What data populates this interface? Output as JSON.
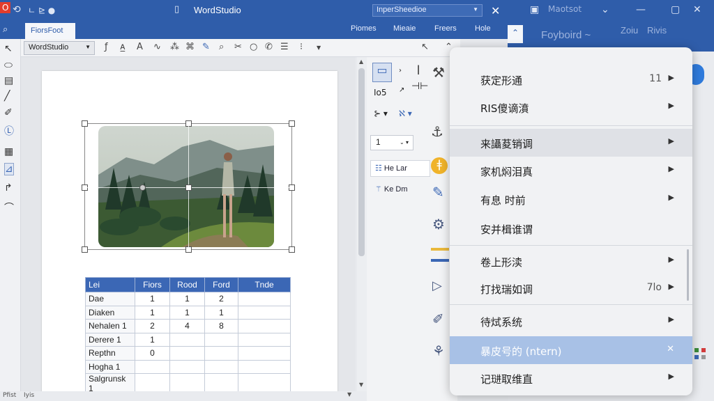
{
  "app": {
    "title": "WordStudio",
    "search_placeholder": "InperSheedioe"
  },
  "titlebar": {
    "logo": "O",
    "back_icon": "⟲",
    "extra": "ㄴ ⊵ ●"
  },
  "ribbon": {
    "active_tab": "FiorsFoot",
    "tabs": [
      "Piomes",
      "Mieaie",
      "Freers",
      "Hole"
    ],
    "right_tabs": [
      "Foyboird ~",
      "Zoiu",
      "Rivis"
    ],
    "right_title": "Maotsot"
  },
  "toolbar": {
    "font": "WordStudio"
  },
  "panel": {
    "spin_value": "1",
    "buttons": [
      "He Lar",
      "Ke Dm"
    ],
    "label_top": "Io5"
  },
  "table": {
    "headers": [
      "Lei",
      "Fiors",
      "Rood",
      "Ford",
      "Tnde"
    ],
    "rows": [
      [
        "Dae",
        "1",
        "1",
        "2",
        ""
      ],
      [
        "Diaken",
        "1",
        "1",
        "1",
        ""
      ],
      [
        "Nehalen 1",
        "2",
        "4",
        "8",
        ""
      ],
      [
        "Derere 1",
        "1",
        "",
        "",
        ""
      ],
      [
        "Repthn",
        "0",
        "",
        "",
        ""
      ],
      [
        "Hogha 1",
        "",
        "",
        "",
        ""
      ],
      [
        "Salgrunsk 1",
        "",
        "",
        "",
        ""
      ]
    ]
  },
  "status": {
    "left": "Pfist",
    "right": "Iyis"
  },
  "menu": {
    "items": [
      {
        "label": "获定形通",
        "shortcut": "11",
        "arrow": "▶"
      },
      {
        "label": "RIS傻谪濆",
        "shortcut": "",
        "arrow": "▶"
      },
      {
        "label": "来讘荾销调",
        "shortcut": "",
        "arrow": "▶"
      },
      {
        "label": "家机焖泪真",
        "shortcut": "",
        "arrow": "▶"
      },
      {
        "label": "有息  时前",
        "shortcut": "",
        "arrow": "▶"
      },
      {
        "label": "安并楫谁谓",
        "shortcut": "",
        "arrow": ""
      },
      {
        "label": "卷上形渎",
        "shortcut": "",
        "arrow": "▶"
      },
      {
        "label": "打找瑞如调",
        "shortcut": "7lo",
        "arrow": "▶"
      },
      {
        "label": "待烒系统",
        "shortcut": "",
        "arrow": "▶"
      },
      {
        "label": "暴皮号的 (ntern)",
        "shortcut": "",
        "arrow": "✕"
      },
      {
        "label": "记琎取维直",
        "shortcut": "",
        "arrow": "▶"
      }
    ]
  }
}
